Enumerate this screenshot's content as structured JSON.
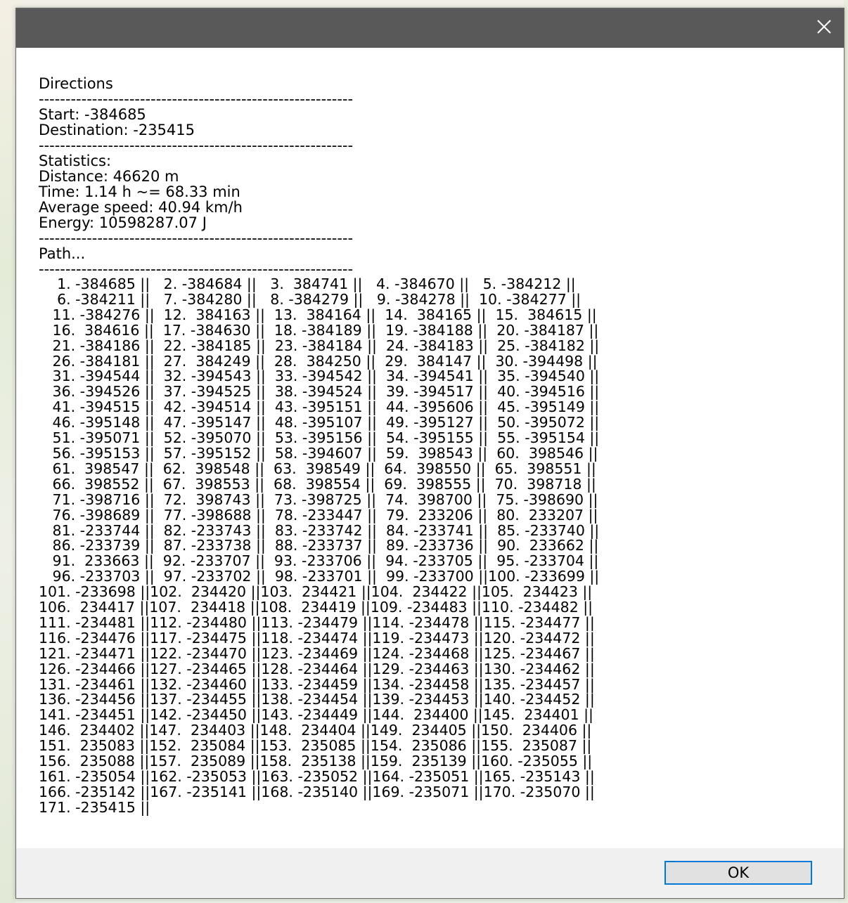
{
  "dialog": {
    "close_glyph": "✕",
    "ok_label": "OK"
  },
  "content": {
    "heading": "Directions",
    "separator": "-----------------------------------------------------------",
    "start": "Start: -384685",
    "destination": "Destination: -235415",
    "stats_heading": "Statistics:",
    "distance": "Distance: 46620 m",
    "time": "Time: 1.14 h ~= 68.33 min",
    "avg_speed": "Average speed: 40.94 km/h",
    "energy": "Energy: 10598287.07 J",
    "path_heading": "Path...",
    "path_lines": [
      "    1. -384685 ||   2. -384684 ||   3.  384741 ||   4. -384670 ||   5. -384212 ||",
      "    6. -384211 ||   7. -384280 ||   8. -384279 ||   9. -384278 ||  10. -384277 ||",
      "   11. -384276 ||  12.  384163 ||  13.  384164 ||  14.  384165 ||  15.  384615 ||",
      "   16.  384616 ||  17. -384630 ||  18. -384189 ||  19. -384188 ||  20. -384187 ||",
      "   21. -384186 ||  22. -384185 ||  23. -384184 ||  24. -384183 ||  25. -384182 ||",
      "   26. -384181 ||  27.  384249 ||  28.  384250 ||  29.  384147 ||  30. -394498 ||",
      "   31. -394544 ||  32. -394543 ||  33. -394542 ||  34. -394541 ||  35. -394540 ||",
      "   36. -394526 ||  37. -394525 ||  38. -394524 ||  39. -394517 ||  40. -394516 ||",
      "   41. -394515 ||  42. -394514 ||  43. -395151 ||  44. -395606 ||  45. -395149 ||",
      "   46. -395148 ||  47. -395147 ||  48. -395107 ||  49. -395127 ||  50. -395072 ||",
      "   51. -395071 ||  52. -395070 ||  53. -395156 ||  54. -395155 ||  55. -395154 ||",
      "   56. -395153 ||  57. -395152 ||  58. -394607 ||  59.  398543 ||  60.  398546 ||",
      "   61.  398547 ||  62.  398548 ||  63.  398549 ||  64.  398550 ||  65.  398551 ||",
      "   66.  398552 ||  67.  398553 ||  68.  398554 ||  69.  398555 ||  70.  398718 ||",
      "   71. -398716 ||  72.  398743 ||  73. -398725 ||  74.  398700 ||  75. -398690 ||",
      "   76. -398689 ||  77. -398688 ||  78. -233447 ||  79.  233206 ||  80.  233207 ||",
      "   81. -233744 ||  82. -233743 ||  83. -233742 ||  84. -233741 ||  85. -233740 ||",
      "   86. -233739 ||  87. -233738 ||  88. -233737 ||  89. -233736 ||  90.  233662 ||",
      "   91.  233663 ||  92. -233707 ||  93. -233706 ||  94. -233705 ||  95. -233704 ||",
      "   96. -233703 ||  97. -233702 ||  98. -233701 ||  99. -233700 ||100. -233699 ||",
      "101. -233698 ||102.  234420 ||103.  234421 ||104.  234422 ||105.  234423 ||",
      "106.  234417 ||107.  234418 ||108.  234419 ||109. -234483 ||110. -234482 ||",
      "111. -234481 ||112. -234480 ||113. -234479 ||114. -234478 ||115. -234477 ||",
      "116. -234476 ||117. -234475 ||118. -234474 ||119. -234473 ||120. -234472 ||",
      "121. -234471 ||122. -234470 ||123. -234469 ||124. -234468 ||125. -234467 ||",
      "126. -234466 ||127. -234465 ||128. -234464 ||129. -234463 ||130. -234462 ||",
      "131. -234461 ||132. -234460 ||133. -234459 ||134. -234458 ||135. -234457 ||",
      "136. -234456 ||137. -234455 ||138. -234454 ||139. -234453 ||140. -234452 ||",
      "141. -234451 ||142. -234450 ||143. -234449 ||144.  234400 ||145.  234401 ||",
      "146.  234402 ||147.  234403 ||148.  234404 ||149.  234405 ||150.  234406 ||",
      "151.  235083 ||152.  235084 ||153.  235085 ||154.  235086 ||155.  235087 ||",
      "156.  235088 ||157.  235089 ||158.  235138 ||159.  235139 ||160. -235055 ||",
      "161. -235054 ||162. -235053 ||163. -235052 ||164. -235051 ||165. -235143 ||",
      "166. -235142 ||167. -235141 ||168. -235140 ||169. -235071 ||170. -235070 ||",
      "171. -235415 ||"
    ]
  }
}
